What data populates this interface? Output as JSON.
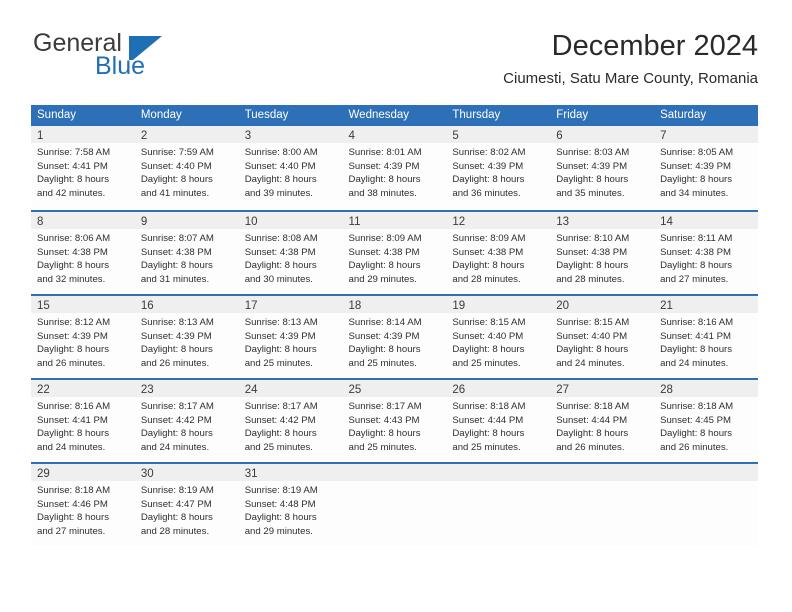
{
  "brand": {
    "name_part1": "General",
    "name_part2": "Blue",
    "flag_icon": "flag-triangle-icon",
    "accent_color": "#1f6fb5"
  },
  "header": {
    "title": "December 2024",
    "subtitle": "Ciumesti, Satu Mare County, Romania"
  },
  "theme": {
    "header_row_color": "#2e70b8",
    "daynum_band_color": "#efefef",
    "text_color": "#2f2f2f"
  },
  "weekday_headers": [
    "Sunday",
    "Monday",
    "Tuesday",
    "Wednesday",
    "Thursday",
    "Friday",
    "Saturday"
  ],
  "weeks": [
    [
      {
        "day": "1",
        "sunrise": "Sunrise: 7:58 AM",
        "sunset": "Sunset: 4:41 PM",
        "daylight_line1": "Daylight: 8 hours",
        "daylight_line2": "and 42 minutes."
      },
      {
        "day": "2",
        "sunrise": "Sunrise: 7:59 AM",
        "sunset": "Sunset: 4:40 PM",
        "daylight_line1": "Daylight: 8 hours",
        "daylight_line2": "and 41 minutes."
      },
      {
        "day": "3",
        "sunrise": "Sunrise: 8:00 AM",
        "sunset": "Sunset: 4:40 PM",
        "daylight_line1": "Daylight: 8 hours",
        "daylight_line2": "and 39 minutes."
      },
      {
        "day": "4",
        "sunrise": "Sunrise: 8:01 AM",
        "sunset": "Sunset: 4:39 PM",
        "daylight_line1": "Daylight: 8 hours",
        "daylight_line2": "and 38 minutes."
      },
      {
        "day": "5",
        "sunrise": "Sunrise: 8:02 AM",
        "sunset": "Sunset: 4:39 PM",
        "daylight_line1": "Daylight: 8 hours",
        "daylight_line2": "and 36 minutes."
      },
      {
        "day": "6",
        "sunrise": "Sunrise: 8:03 AM",
        "sunset": "Sunset: 4:39 PM",
        "daylight_line1": "Daylight: 8 hours",
        "daylight_line2": "and 35 minutes."
      },
      {
        "day": "7",
        "sunrise": "Sunrise: 8:05 AM",
        "sunset": "Sunset: 4:39 PM",
        "daylight_line1": "Daylight: 8 hours",
        "daylight_line2": "and 34 minutes."
      }
    ],
    [
      {
        "day": "8",
        "sunrise": "Sunrise: 8:06 AM",
        "sunset": "Sunset: 4:38 PM",
        "daylight_line1": "Daylight: 8 hours",
        "daylight_line2": "and 32 minutes."
      },
      {
        "day": "9",
        "sunrise": "Sunrise: 8:07 AM",
        "sunset": "Sunset: 4:38 PM",
        "daylight_line1": "Daylight: 8 hours",
        "daylight_line2": "and 31 minutes."
      },
      {
        "day": "10",
        "sunrise": "Sunrise: 8:08 AM",
        "sunset": "Sunset: 4:38 PM",
        "daylight_line1": "Daylight: 8 hours",
        "daylight_line2": "and 30 minutes."
      },
      {
        "day": "11",
        "sunrise": "Sunrise: 8:09 AM",
        "sunset": "Sunset: 4:38 PM",
        "daylight_line1": "Daylight: 8 hours",
        "daylight_line2": "and 29 minutes."
      },
      {
        "day": "12",
        "sunrise": "Sunrise: 8:09 AM",
        "sunset": "Sunset: 4:38 PM",
        "daylight_line1": "Daylight: 8 hours",
        "daylight_line2": "and 28 minutes."
      },
      {
        "day": "13",
        "sunrise": "Sunrise: 8:10 AM",
        "sunset": "Sunset: 4:38 PM",
        "daylight_line1": "Daylight: 8 hours",
        "daylight_line2": "and 28 minutes."
      },
      {
        "day": "14",
        "sunrise": "Sunrise: 8:11 AM",
        "sunset": "Sunset: 4:38 PM",
        "daylight_line1": "Daylight: 8 hours",
        "daylight_line2": "and 27 minutes."
      }
    ],
    [
      {
        "day": "15",
        "sunrise": "Sunrise: 8:12 AM",
        "sunset": "Sunset: 4:39 PM",
        "daylight_line1": "Daylight: 8 hours",
        "daylight_line2": "and 26 minutes."
      },
      {
        "day": "16",
        "sunrise": "Sunrise: 8:13 AM",
        "sunset": "Sunset: 4:39 PM",
        "daylight_line1": "Daylight: 8 hours",
        "daylight_line2": "and 26 minutes."
      },
      {
        "day": "17",
        "sunrise": "Sunrise: 8:13 AM",
        "sunset": "Sunset: 4:39 PM",
        "daylight_line1": "Daylight: 8 hours",
        "daylight_line2": "and 25 minutes."
      },
      {
        "day": "18",
        "sunrise": "Sunrise: 8:14 AM",
        "sunset": "Sunset: 4:39 PM",
        "daylight_line1": "Daylight: 8 hours",
        "daylight_line2": "and 25 minutes."
      },
      {
        "day": "19",
        "sunrise": "Sunrise: 8:15 AM",
        "sunset": "Sunset: 4:40 PM",
        "daylight_line1": "Daylight: 8 hours",
        "daylight_line2": "and 25 minutes."
      },
      {
        "day": "20",
        "sunrise": "Sunrise: 8:15 AM",
        "sunset": "Sunset: 4:40 PM",
        "daylight_line1": "Daylight: 8 hours",
        "daylight_line2": "and 24 minutes."
      },
      {
        "day": "21",
        "sunrise": "Sunrise: 8:16 AM",
        "sunset": "Sunset: 4:41 PM",
        "daylight_line1": "Daylight: 8 hours",
        "daylight_line2": "and 24 minutes."
      }
    ],
    [
      {
        "day": "22",
        "sunrise": "Sunrise: 8:16 AM",
        "sunset": "Sunset: 4:41 PM",
        "daylight_line1": "Daylight: 8 hours",
        "daylight_line2": "and 24 minutes."
      },
      {
        "day": "23",
        "sunrise": "Sunrise: 8:17 AM",
        "sunset": "Sunset: 4:42 PM",
        "daylight_line1": "Daylight: 8 hours",
        "daylight_line2": "and 24 minutes."
      },
      {
        "day": "24",
        "sunrise": "Sunrise: 8:17 AM",
        "sunset": "Sunset: 4:42 PM",
        "daylight_line1": "Daylight: 8 hours",
        "daylight_line2": "and 25 minutes."
      },
      {
        "day": "25",
        "sunrise": "Sunrise: 8:17 AM",
        "sunset": "Sunset: 4:43 PM",
        "daylight_line1": "Daylight: 8 hours",
        "daylight_line2": "and 25 minutes."
      },
      {
        "day": "26",
        "sunrise": "Sunrise: 8:18 AM",
        "sunset": "Sunset: 4:44 PM",
        "daylight_line1": "Daylight: 8 hours",
        "daylight_line2": "and 25 minutes."
      },
      {
        "day": "27",
        "sunrise": "Sunrise: 8:18 AM",
        "sunset": "Sunset: 4:44 PM",
        "daylight_line1": "Daylight: 8 hours",
        "daylight_line2": "and 26 minutes."
      },
      {
        "day": "28",
        "sunrise": "Sunrise: 8:18 AM",
        "sunset": "Sunset: 4:45 PM",
        "daylight_line1": "Daylight: 8 hours",
        "daylight_line2": "and 26 minutes."
      }
    ],
    [
      {
        "day": "29",
        "sunrise": "Sunrise: 8:18 AM",
        "sunset": "Sunset: 4:46 PM",
        "daylight_line1": "Daylight: 8 hours",
        "daylight_line2": "and 27 minutes."
      },
      {
        "day": "30",
        "sunrise": "Sunrise: 8:19 AM",
        "sunset": "Sunset: 4:47 PM",
        "daylight_line1": "Daylight: 8 hours",
        "daylight_line2": "and 28 minutes."
      },
      {
        "day": "31",
        "sunrise": "Sunrise: 8:19 AM",
        "sunset": "Sunset: 4:48 PM",
        "daylight_line1": "Daylight: 8 hours",
        "daylight_line2": "and 29 minutes."
      },
      null,
      null,
      null,
      null
    ]
  ]
}
